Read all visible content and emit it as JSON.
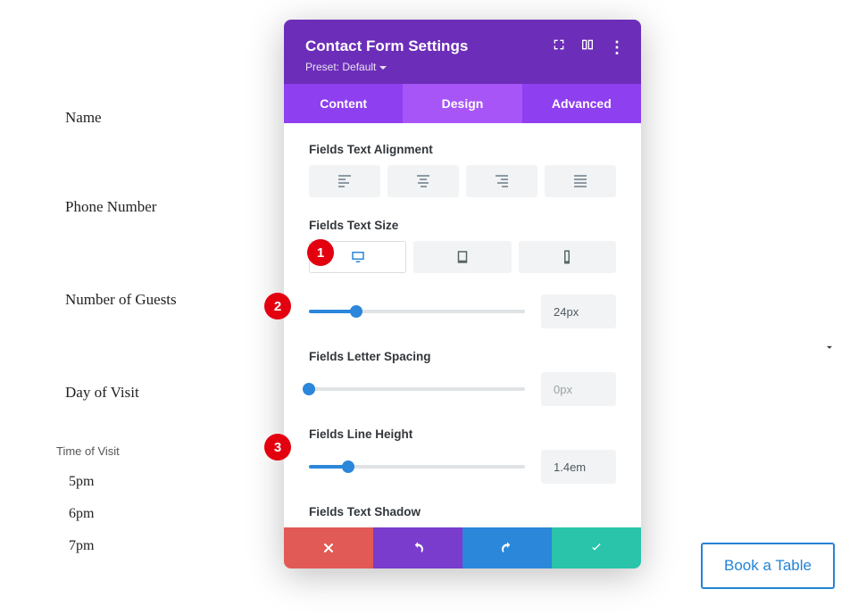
{
  "form": {
    "fields": [
      "Name",
      "Phone Number",
      "Number of Guests",
      "Day of Visit"
    ],
    "radio_title": "Time of Visit",
    "radio_options": [
      "5pm",
      "6pm",
      "7pm"
    ],
    "submit": "Book a Table"
  },
  "panel": {
    "title": "Contact Form Settings",
    "preset": "Preset: Default",
    "tabs": {
      "content": "Content",
      "design": "Design",
      "advanced": "Advanced"
    },
    "sections": {
      "alignment": "Fields Text Alignment",
      "size": "Fields Text Size",
      "spacing": "Fields Letter Spacing",
      "lineheight": "Fields Line Height",
      "shadow": "Fields Text Shadow"
    },
    "values": {
      "size": "24px",
      "spacing": "0px",
      "lineheight": "1.4em"
    }
  },
  "badges": {
    "b1": "1",
    "b2": "2",
    "b3": "3"
  }
}
